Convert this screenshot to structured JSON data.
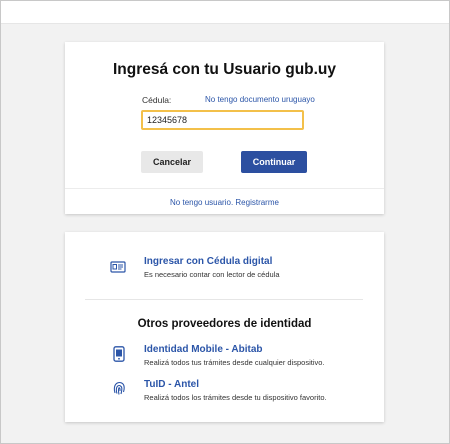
{
  "login": {
    "title": "Ingresá con tu Usuario gub.uy",
    "cedula_label": "Cédula:",
    "no_document_link": "No tengo documento uruguayo",
    "cedula_value": "12345678",
    "cancel_label": "Cancelar",
    "continue_label": "Continuar",
    "register_link": "No tengo usuario. Registrarme"
  },
  "providers": {
    "cedula_digital": {
      "title": "Ingresar con Cédula digital",
      "description": "Es necesario contar con lector de cédula",
      "icon": "id-card-reader-icon"
    },
    "section_title": "Otros proveedores de identidad",
    "items": [
      {
        "title": "Identidad Mobile - Abitab",
        "description": "Realizá todos tus trámites desde cualquier dispositivo.",
        "icon": "mobile-phone-icon"
      },
      {
        "title": "TuID - Antel",
        "description": "Realizá todos los trámites desde tu dispositivo favorito.",
        "icon": "fingerprint-icon"
      }
    ]
  },
  "colors": {
    "accent": "#2c4fa0",
    "link": "#2b55a8",
    "input_focus_border": "#f3c04a",
    "background": "#f2f2f2"
  }
}
